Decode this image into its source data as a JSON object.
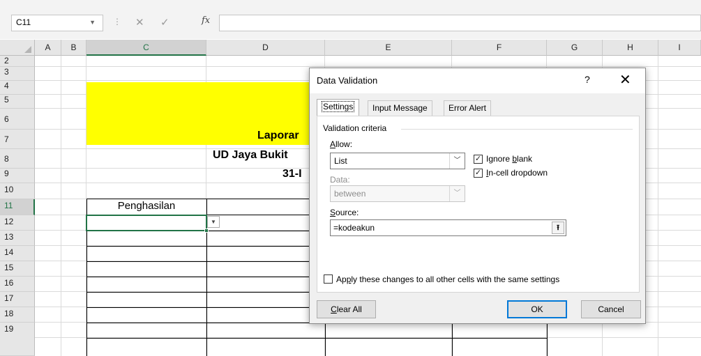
{
  "formula_bar": {
    "name_box": "C11",
    "cancel_glyph": "✕",
    "enter_glyph": "✓",
    "fx_label": "fx",
    "formula": ""
  },
  "sheet": {
    "columns": [
      "A",
      "B",
      "C",
      "D",
      "E",
      "F",
      "G",
      "H",
      "I"
    ],
    "rows": [
      "2",
      "3",
      "4",
      "5",
      "6",
      "7",
      "8",
      "9",
      "10",
      "11",
      "12",
      "13",
      "14",
      "15",
      "16",
      "17",
      "18",
      "19"
    ],
    "selected_column": "C",
    "selected_row": "11",
    "title_line1": "Laporar",
    "title_line2": "UD Jaya Bukit",
    "title_line3": "31-I",
    "cell_c10": "Penghasilan",
    "highlight_color": "#ffff00",
    "selection_color": "#217346"
  },
  "dialog": {
    "title": "Data Validation",
    "help": "?",
    "close": "✕",
    "tabs": [
      "Settings",
      "Input Message",
      "Error Alert"
    ],
    "active_tab": "Settings",
    "group_label": "Validation criteria",
    "allow_label": "Allow:",
    "allow_value": "List",
    "data_label": "Data:",
    "data_value": "between",
    "ignore_blank_label": "Ignore blank",
    "ignore_blank_checked": true,
    "in_cell_dropdown_label": "In-cell dropdown",
    "in_cell_dropdown_checked": true,
    "source_label": "Source:",
    "source_value": "=kodeakun",
    "apply_all_label": "Apply these changes to all other cells with the same settings",
    "apply_all_checked": false,
    "clear_all_label": "Clear All",
    "ok_label": "OK",
    "cancel_label": "Cancel",
    "accent_color": "#0078d7"
  }
}
